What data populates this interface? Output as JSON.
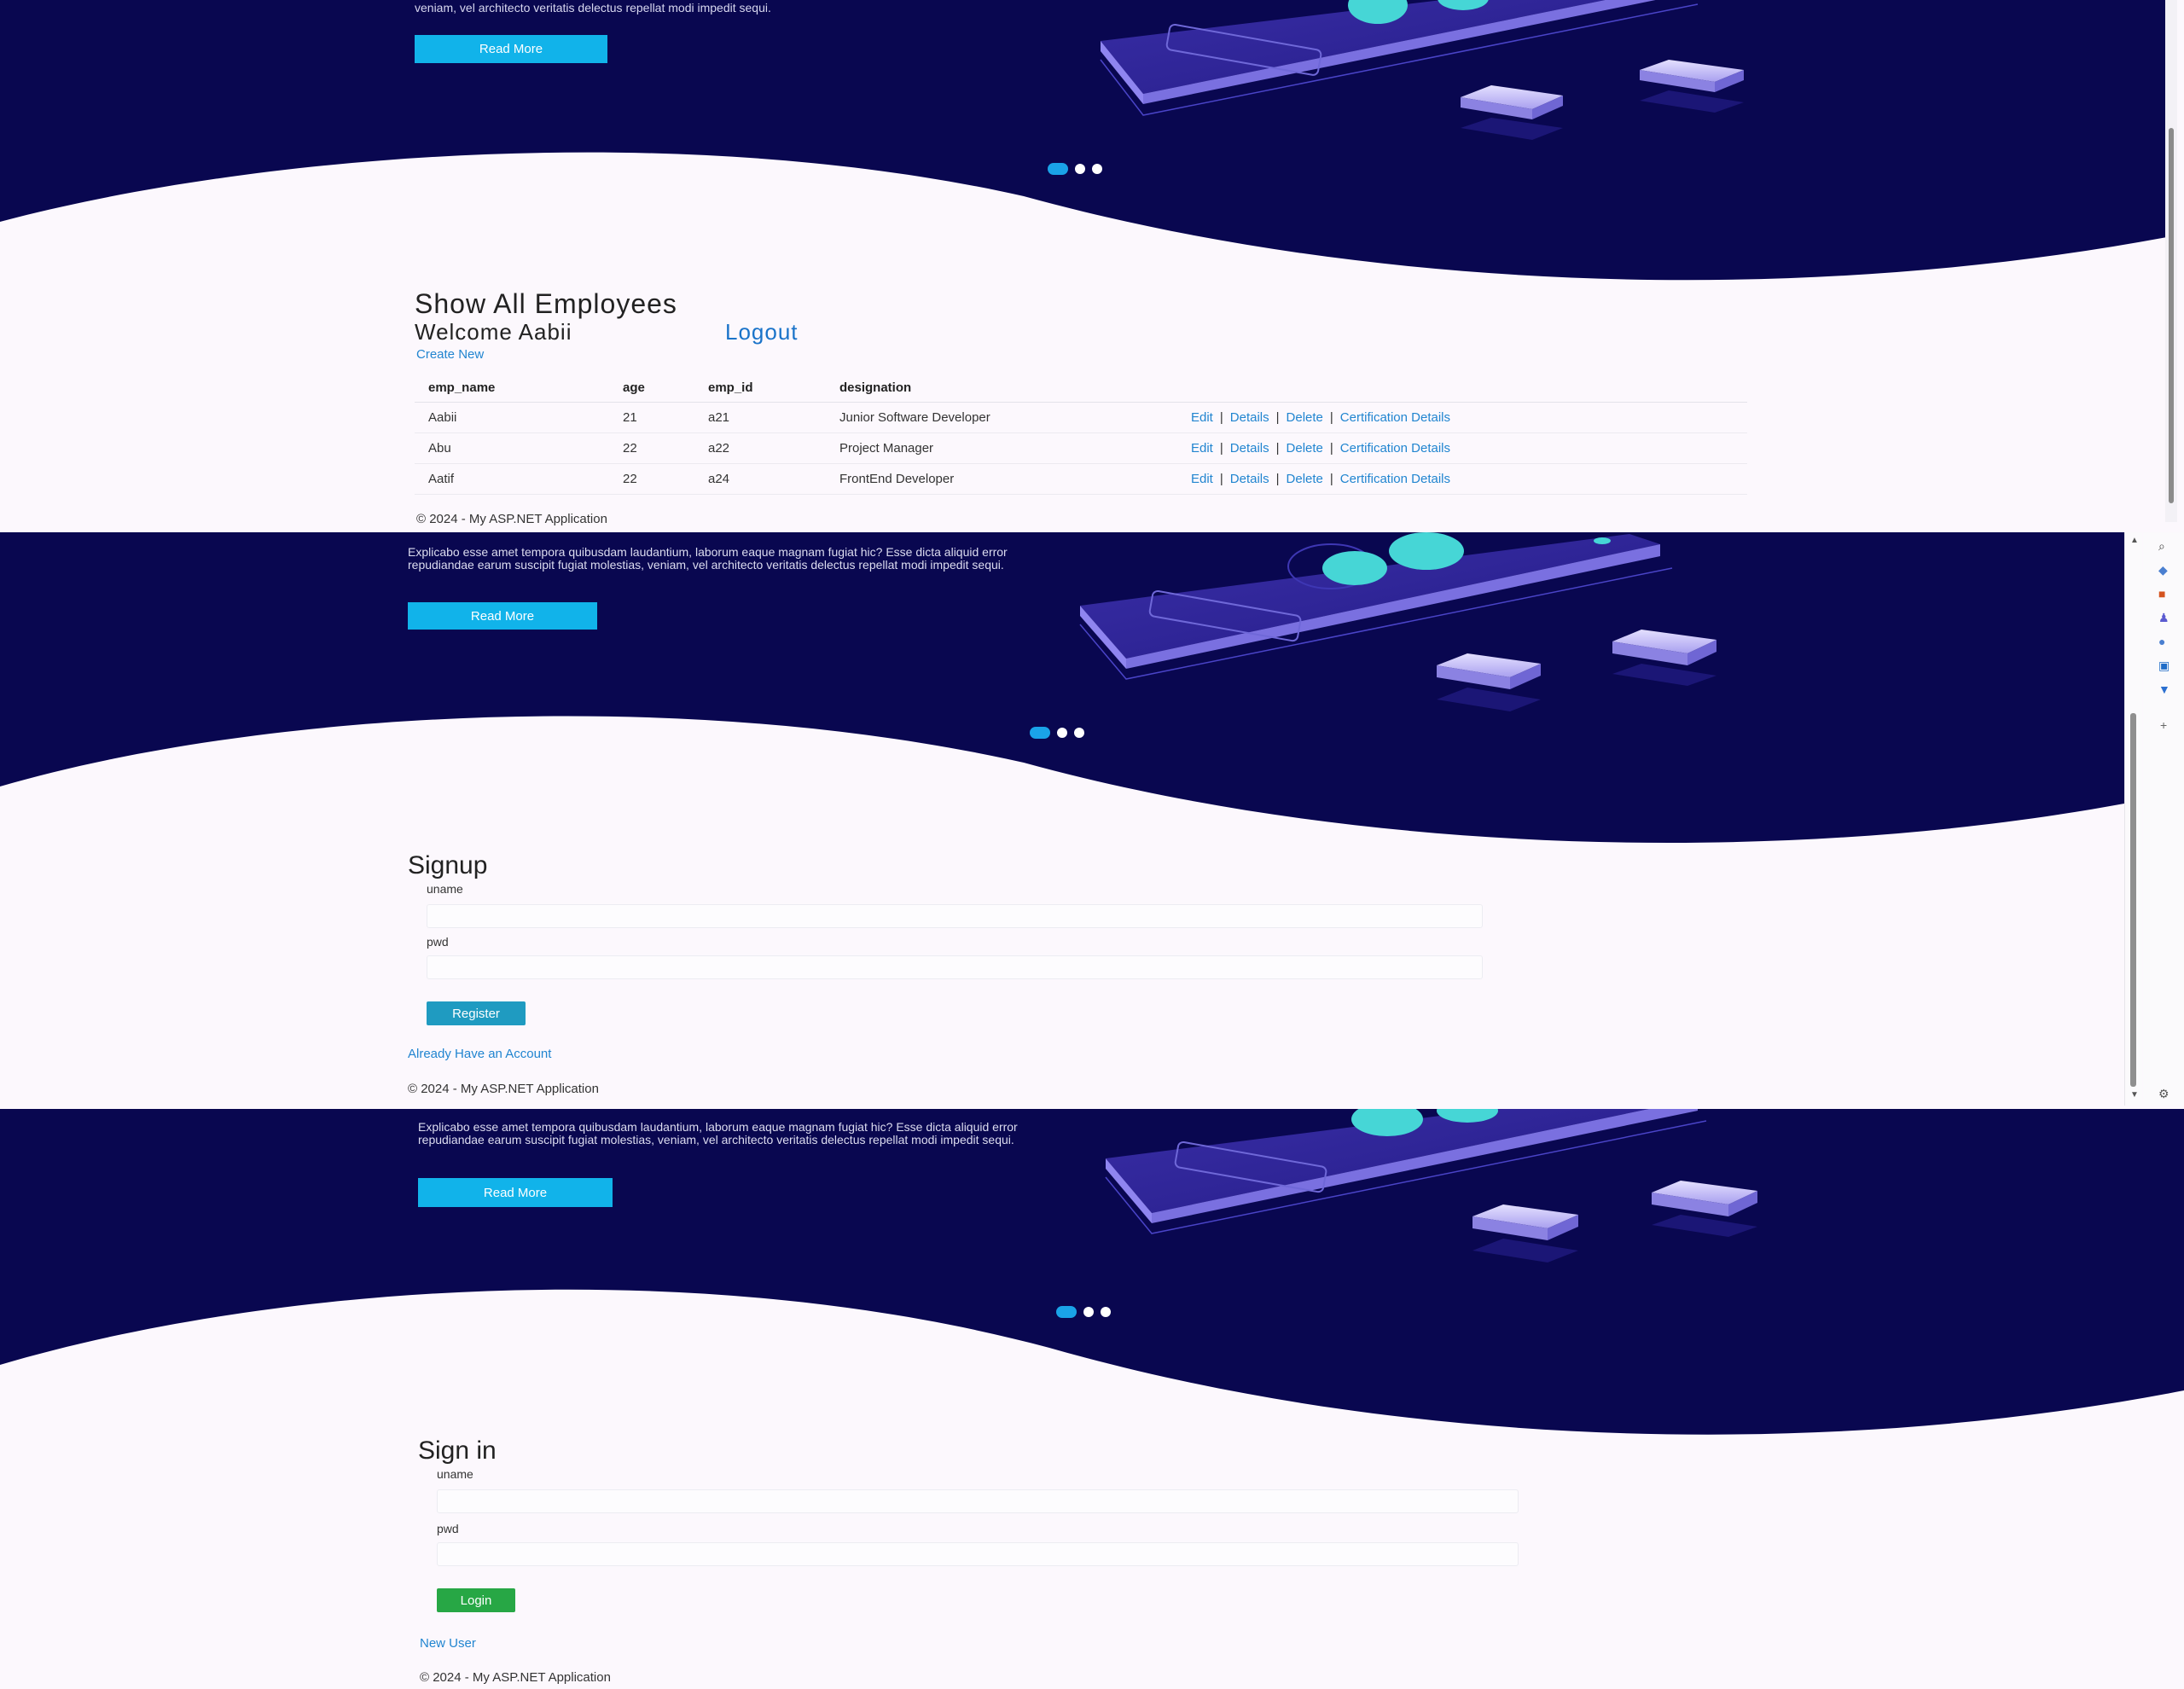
{
  "panels": {
    "employees": {
      "hero": {
        "text": "veniam, vel architecto veritatis delectus repellat modi impedit sequi.",
        "read_more": "Read More"
      },
      "page_title": "Show All Employees",
      "welcome": "Welcome Aabii",
      "logout": "Logout",
      "create_new": "Create New",
      "columns": [
        "emp_name",
        "age",
        "emp_id",
        "designation"
      ],
      "rows": [
        {
          "emp_name": "Aabii",
          "age": "21",
          "emp_id": "a21",
          "designation": "Junior Software Developer"
        },
        {
          "emp_name": "Abu",
          "age": "22",
          "emp_id": "a22",
          "designation": "Project Manager"
        },
        {
          "emp_name": "Aatif",
          "age": "22",
          "emp_id": "a24",
          "designation": "FrontEnd Developer"
        }
      ],
      "actions": {
        "edit": "Edit",
        "details": "Details",
        "delete": "Delete",
        "cert": "Certification Details"
      },
      "footer": "© 2024 - My ASP.NET Application"
    },
    "signup": {
      "hero": {
        "text": "Explicabo esse amet tempora quibusdam laudantium, laborum eaque magnam fugiat hic? Esse dicta aliquid error repudiandae earum suscipit fugiat molestias, veniam, vel architecto veritatis delectus repellat modi impedit sequi.",
        "read_more": "Read More"
      },
      "title": "Signup",
      "uname_label": "uname",
      "pwd_label": "pwd",
      "register": "Register",
      "already": "Already Have an Account",
      "footer": "© 2024 - My ASP.NET Application"
    },
    "signin": {
      "hero": {
        "text": "Explicabo esse amet tempora quibusdam laudantium, laborum eaque magnam fugiat hic? Esse dicta aliquid error repudiandae earum suscipit fugiat molestias, veniam, vel architecto veritatis delectus repellat modi impedit sequi.",
        "read_more": "Read More"
      },
      "title": "Sign in",
      "uname_label": "uname",
      "pwd_label": "pwd",
      "login": "Login",
      "new_user": "New User",
      "footer": "© 2024 - My ASP.NET Application"
    }
  },
  "colors": {
    "hero_bg": "#090750",
    "accent": "#11b3ea",
    "register": "#1f9bc1",
    "login": "#27a745",
    "link": "#2185d0"
  },
  "carousel": {
    "slides": 3,
    "active": 1
  }
}
